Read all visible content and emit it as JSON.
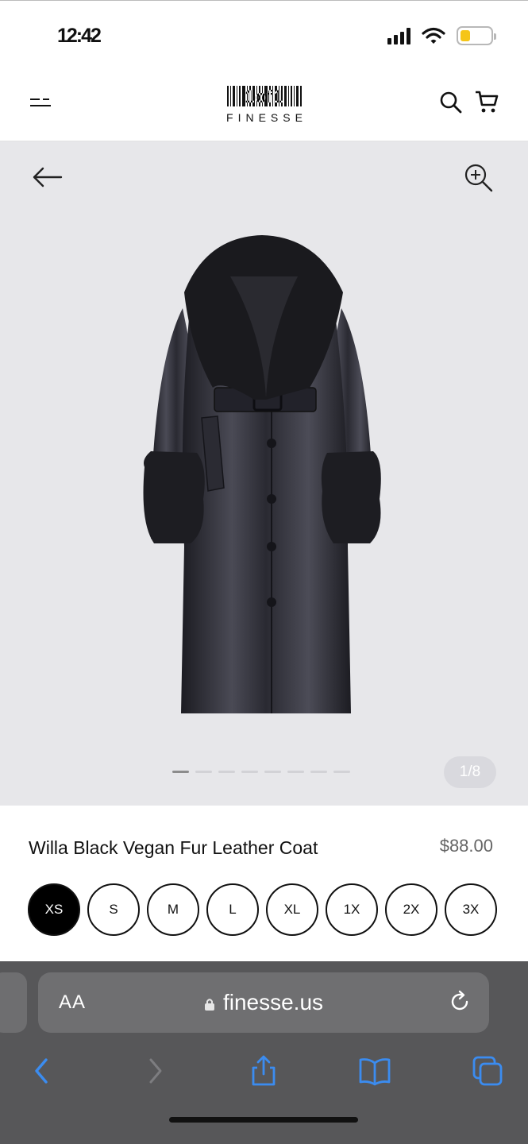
{
  "status_bar": {
    "time": "12:42",
    "icons": [
      "cellular-signal-icon",
      "wifi-icon",
      "battery-icon"
    ]
  },
  "header": {
    "logo_barcode_text": "1of1",
    "logo_word": "FINESSE",
    "icons": [
      "menu-icon",
      "search-icon",
      "cart-icon"
    ]
  },
  "gallery": {
    "counter": "1/8",
    "image_total": 8,
    "active_index": 1
  },
  "product": {
    "title": "Willa Black Vegan Fur Leather Coat",
    "price": "$88.00",
    "sizes": [
      "XS",
      "S",
      "M",
      "L",
      "XL",
      "1X",
      "2X",
      "3X"
    ],
    "selected_size": "XS"
  },
  "browser": {
    "text_size_label": "AA",
    "url": "finesse.us",
    "toolbar_icons": [
      "back-icon",
      "forward-icon",
      "share-icon",
      "bookmarks-icon",
      "tabs-icon"
    ]
  },
  "colors": {
    "gallery_bg": "#e7e7ea",
    "browser_bar": "#575759",
    "toolbar_accent": "#3b8cf0",
    "battery_fill": "#f5c518"
  }
}
